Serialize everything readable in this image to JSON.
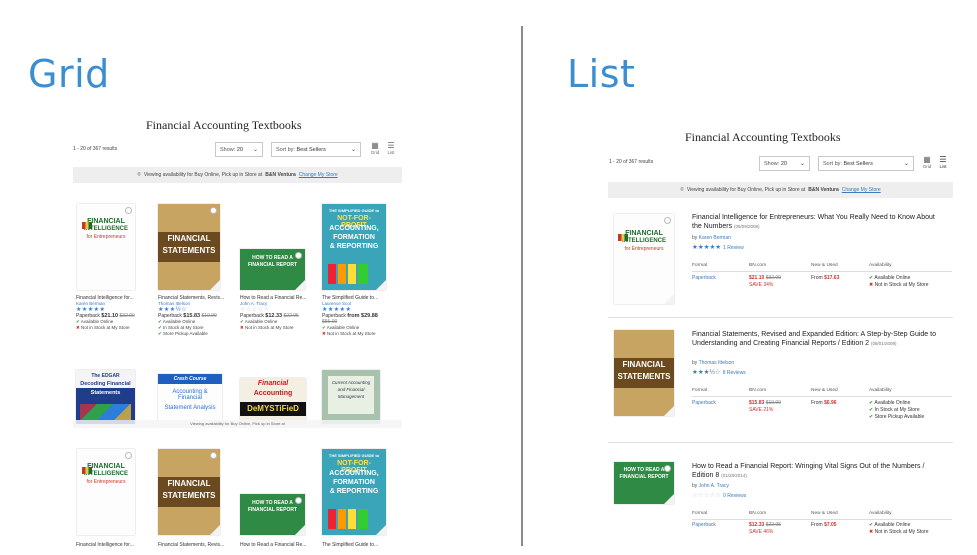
{
  "headings": {
    "grid": "Grid",
    "list": "List"
  },
  "grid": {
    "title": "Financial Accounting Textbooks",
    "results": "1 - 20 of 367 results",
    "show_label": "Show:",
    "show_value": "20",
    "sort_label": "Sort by:",
    "sort_value": "Best Sellers",
    "view_grid": "Grid",
    "view_list": "List",
    "availability_text": "Viewing availability for Buy Online, Pick up in Store at",
    "store": "B&N Ventura",
    "change_store": "Change My Store",
    "books": [
      {
        "title": "Financial Intelligence for...",
        "author": "Karen Berman",
        "stars": "★★★★★",
        "format": "Paperback",
        "price": "$21.10",
        "list_price": "$32.00",
        "av": [
          "Available Online",
          "Not in Stock at My Store"
        ]
      },
      {
        "title": "Financial Statements, Revis...",
        "author": "Thomas Ittelson",
        "stars": "★★★½☆",
        "format": "Paperback",
        "price": "$15.83",
        "list_price": "$19.99",
        "av": [
          "Available Online",
          "In Stock at My Store",
          "Store Pickup Available"
        ]
      },
      {
        "title": "How to Read a Financial Re...",
        "author": "John A. Tracy",
        "stars": "☆☆☆☆☆",
        "format": "Paperback",
        "price": "$12.33",
        "list_price": "$22.95",
        "av": [
          "Available Online",
          "Not in Stock at My Store"
        ]
      },
      {
        "title": "The Simplified Guide to...",
        "author": "Laurence Scot",
        "stars": "★★★★★",
        "format": "Paperback",
        "price": "from $29.88",
        "list_price": "$55.00",
        "av": [
          "Available Online",
          "Not in Stock at My Store"
        ]
      }
    ],
    "second_row_covers": [
      {
        "line1": "The EDGAR",
        "line2": "Decoding Financial",
        "line3": "Statements"
      },
      {
        "line1": "Crash Course",
        "line2": "Accounting & Financial",
        "line3": "Statement Analysis"
      },
      {
        "line1": "Financial",
        "line2": "Accounting",
        "line3": "DeMYSTiFieD"
      },
      {
        "line1": "Current Accounting",
        "line2": "and Financial",
        "line3": "Management"
      }
    ],
    "overlay_text": "Viewing availability for Buy Online, Pick up in Store at",
    "third_row_titles": [
      "Financial Intelligence for...",
      "Financial Statements, Revis...",
      "How to Read a Financial Re...",
      "The Simplified Guide to..."
    ]
  },
  "covers": {
    "fi": {
      "top": "FINANCIAL",
      "mid": "INTELLIGENCE",
      "sub": "for Entrepreneurs"
    },
    "fs": {
      "top": "FINANCIAL",
      "mid": "STATEMENTS"
    },
    "hr": {
      "top": "HOW TO READ A",
      "mid": "FINANCIAL REPORT"
    },
    "np": {
      "top": "THE SIMPLIFIED GUIDE to",
      "mid": "NOT-FOR-PROFIT",
      "l3": "ACCOUNTING,",
      "l4": "FORMATION",
      "l5": "& REPORTING"
    }
  },
  "list": {
    "title": "Financial Accounting Textbooks",
    "results": "1 - 20 of 367 results",
    "show_label": "Show:",
    "show_value": "20",
    "sort_label": "Sort by:",
    "sort_value": "Best Sellers",
    "view_grid": "Grid",
    "view_list": "List",
    "availability_text": "Viewing availability for Buy Online, Pick up in Store at",
    "store": "B&N Ventura",
    "change_store": "Change My Store",
    "columns": {
      "format": "Format",
      "bn": "BN.com",
      "new_used": "New & Used",
      "availability": "Availability"
    },
    "items": [
      {
        "title": "Financial Intelligence for Entrepreneurs: What You Really Need to Know About the Numbers",
        "date": "(09/09/2008)",
        "author": "Karen Berman",
        "stars": "★★★★★",
        "reviews": "1 Review",
        "format": "Paperback",
        "price": "$21.10",
        "list_price": "$32.00",
        "save": "SAVE 34%",
        "from_label": "From",
        "from_price": "$17.63",
        "av": [
          "Available Online",
          "Not in Stock at My Store"
        ]
      },
      {
        "title": "Financial Statements, Revised and Expanded Edition: A Step-by-Step Guide to Understanding and Creating Financial Reports / Edition 2",
        "date": "(08/01/2009)",
        "author": "Thomas Ittelson",
        "stars": "★★★½☆",
        "reviews": "8 Reviews",
        "format": "Paperback",
        "price": "$15.83",
        "list_price": "$19.99",
        "save": "SAVE 21%",
        "from_label": "From",
        "from_price": "$6.96",
        "av": [
          "Available Online",
          "In Stock at My Store",
          "Store Pickup Available"
        ]
      },
      {
        "title": "How to Read a Financial Report: Wringing Vital Signs Out of the Numbers / Edition 8",
        "date": "(01/28/2014)",
        "author": "John A. Tracy",
        "stars": "☆☆☆☆☆",
        "reviews": "0 Reviews",
        "format": "Paperback",
        "price": "$12.33",
        "list_price": "$22.95",
        "save": "SAVE 46%",
        "from_label": "From",
        "from_price": "$7.05",
        "av": [
          "Available Online",
          "Not in Stock at My Store"
        ]
      }
    ]
  },
  "by": "by",
  "colors": {
    "accent": "#3b8fd0",
    "link": "#3a7bbf",
    "sale": "#d0302f"
  }
}
